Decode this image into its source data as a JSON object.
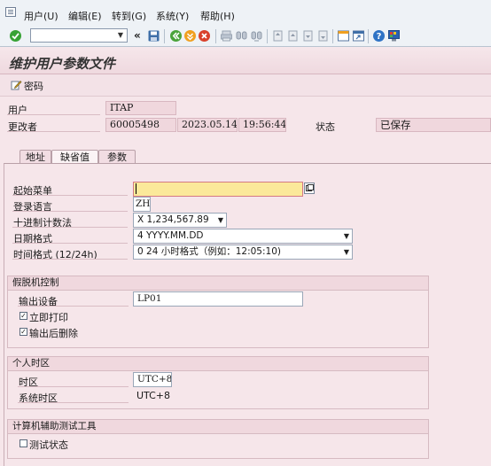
{
  "menu": {
    "items": [
      "用户(U)",
      "编辑(E)",
      "转到(G)",
      "系统(Y)",
      "帮助(H)"
    ]
  },
  "toolbar": {
    "command_value": "",
    "collapse_glyph": "«"
  },
  "page": {
    "title": "维护用户参数文件",
    "password_button": "密码"
  },
  "header": {
    "user_label": "用户",
    "user_value": "ITAP",
    "changed_by_label": "更改者",
    "changed_by_value": "60005498",
    "changed_date": "2023.05.14",
    "changed_time": "19:56:44",
    "status_label": "状态",
    "status_value": "已保存"
  },
  "tabs": [
    {
      "label": "地址",
      "active": false
    },
    {
      "label": "缺省值",
      "active": true
    },
    {
      "label": "参数",
      "active": false
    }
  ],
  "defaults": {
    "start_menu_label": "起始菜单",
    "start_menu_value": "",
    "logon_language_label": "登录语言",
    "logon_language_value": "ZH",
    "decimal_notation_label": "十进制计数法",
    "decimal_notation_value": "X 1,234,567.89",
    "date_format_label": "日期格式",
    "date_format_value": "4 YYYY.MM.DD",
    "time_format_label": "时间格式 (12/24h)",
    "time_format_value": "0 24 小时格式（例如：12:05:10)"
  },
  "spool": {
    "title": "假脱机控制",
    "output_device_label": "输出设备",
    "output_device_value": "LP01",
    "print_immediately_label": "立即打印",
    "print_immediately_checked": true,
    "delete_after_output_label": "输出后删除",
    "delete_after_output_checked": true
  },
  "timezone": {
    "title": "个人时区",
    "timezone_label": "时区",
    "timezone_value": "UTC+8",
    "system_timezone_label": "系统时区",
    "system_timezone_value": "UTC+8"
  },
  "catt": {
    "title": "计算机辅助测试工具",
    "test_status_label": "测试状态",
    "test_status_checked": false
  },
  "icons": [
    "app-menu-icon",
    "enter-icon",
    "save-icon",
    "back-icon",
    "exit-icon",
    "cancel-icon",
    "print-icon",
    "find-icon",
    "find-next-icon",
    "first-page-icon",
    "previous-page-icon",
    "next-page-icon",
    "last-page-icon",
    "create-session-icon",
    "shortcut-icon",
    "help-icon",
    "customize-layout-icon",
    "edit-pencil-icon",
    "match-code-icon"
  ]
}
